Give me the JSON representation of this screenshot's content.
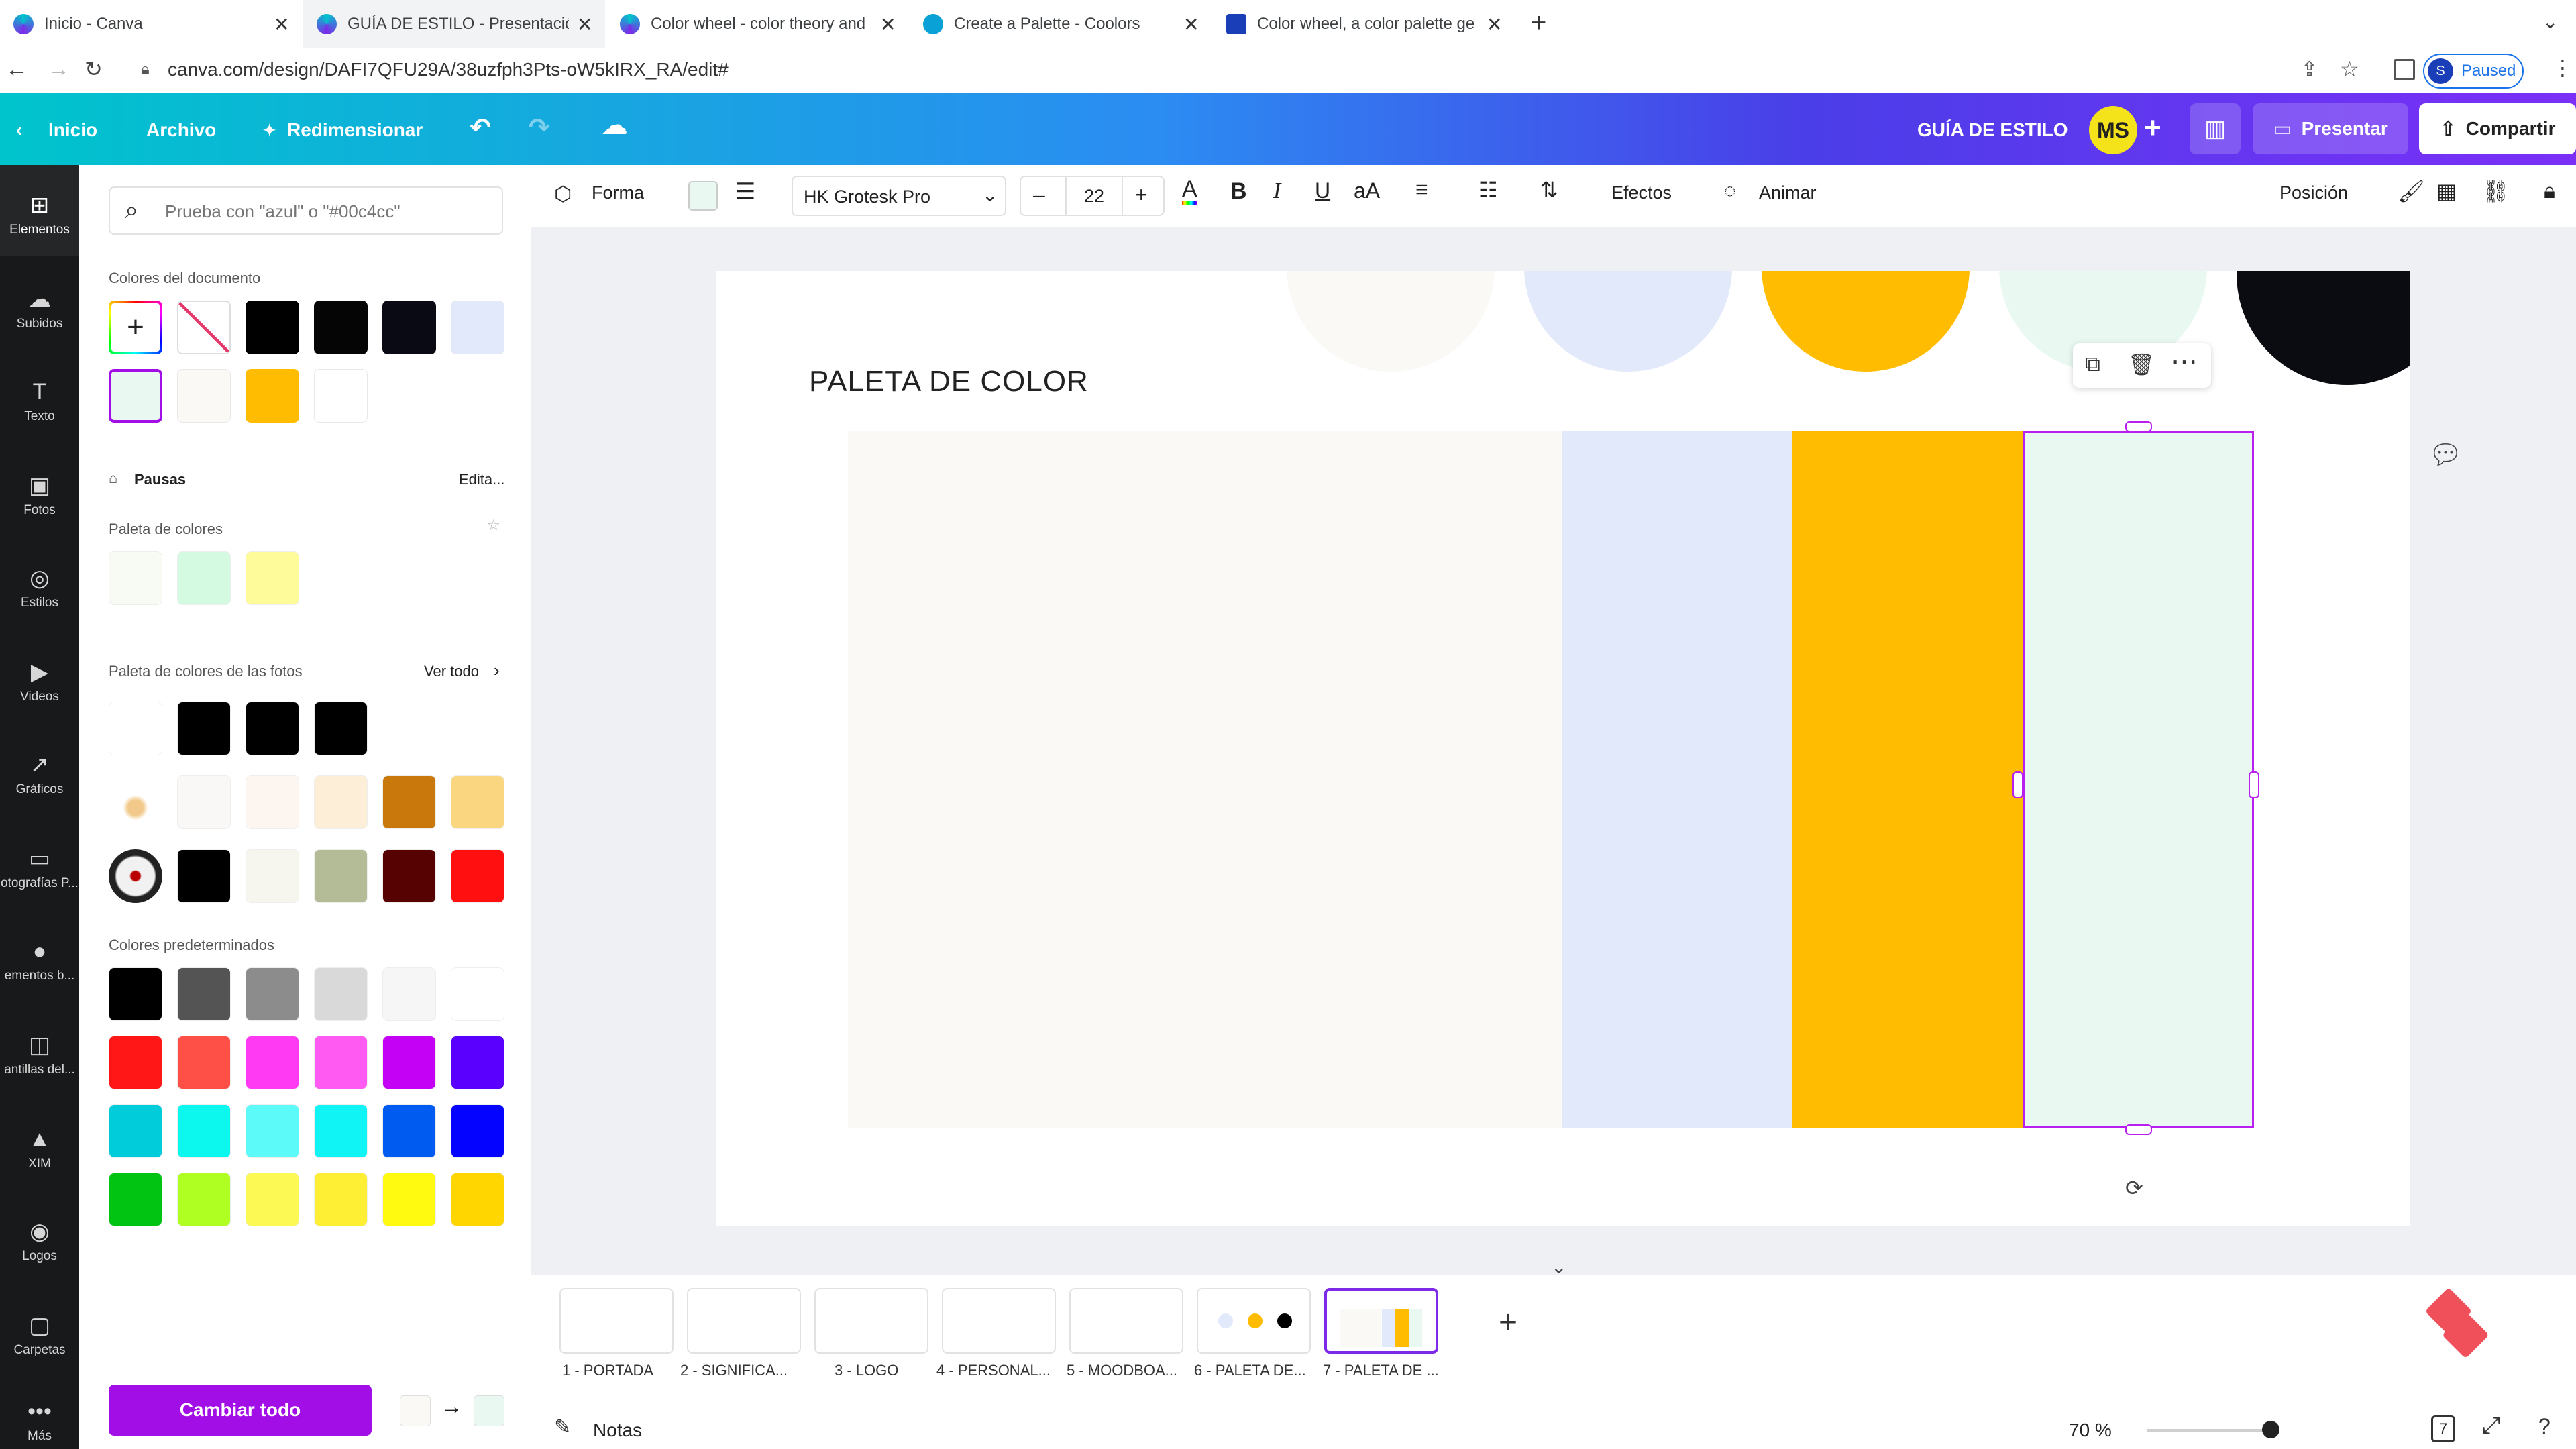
{
  "browser": {
    "tabs": [
      {
        "title": "Inicio - Canva"
      },
      {
        "title": "GUÍA DE ESTILO - Presentació"
      },
      {
        "title": "Color wheel - color theory and"
      },
      {
        "title": "Create a Palette - Coolors"
      },
      {
        "title": "Color wheel, a color palette ge"
      }
    ],
    "url": "canva.com/design/DAFI7QFU29A/38uzfph3Pts-oW5kIRX_RA/edit#",
    "profile_letter": "S",
    "profile_status": "Paused"
  },
  "header": {
    "home": "Inicio",
    "file": "Archivo",
    "resize": "Redimensionar",
    "design_title": "GUÍA DE ESTILO",
    "avatar": "MS",
    "present": "Presentar",
    "share": "Compartir"
  },
  "rail": [
    {
      "label": "Elementos"
    },
    {
      "label": "Subidos"
    },
    {
      "label": "Texto"
    },
    {
      "label": "Fotos"
    },
    {
      "label": "Estilos"
    },
    {
      "label": "Videos"
    },
    {
      "label": "Gráficos"
    },
    {
      "label": "otografías P..."
    },
    {
      "label": "ementos b..."
    },
    {
      "label": "antillas del..."
    },
    {
      "label": "XIM"
    },
    {
      "label": "Logos"
    },
    {
      "label": "Carpetas"
    },
    {
      "label": "Más"
    }
  ],
  "panel": {
    "search_placeholder": "Prueba con \"azul\" o \"#00c4cc\"",
    "doc_colors_title": "Colores del documento",
    "doc_colors": [
      "#000000",
      "#050505",
      "#0a0a14",
      "#e2e9fb",
      "#e9f9f1",
      "#faf9f5",
      "#ffbc00",
      "#ffffff"
    ],
    "brand_kit": "Pausas",
    "edit": "Edita...",
    "palette_title": "Paleta de colores",
    "palette": [
      "#f8faf4",
      "#d4fbe2",
      "#fdfb9a"
    ],
    "photo_palette_title": "Paleta de colores de las fotos",
    "see_all": "Ver todo",
    "photo_rows": [
      [
        "#000000",
        "#000000",
        "#000000"
      ],
      [
        "#f9f8f6",
        "#fdf6f0",
        "#fdefd7",
        "#c9790c",
        "#f9d67f"
      ],
      [
        "#000000",
        "#f6f6ef",
        "#b4bc97",
        "#570202",
        "#ff0f0f"
      ]
    ],
    "default_title": "Colores predeterminados",
    "default_colors": [
      [
        "#000000",
        "#545454",
        "#8c8c8c",
        "#d9d9d9",
        "#f6f6f6",
        "#ffffff"
      ],
      [
        "#ff1616",
        "#ff5048",
        "#ff3af2",
        "#ff5bf2",
        "#c400f5",
        "#5a00ff"
      ],
      [
        "#00cdd9",
        "#0cf7ee",
        "#5cfaf9",
        "#10f4f6",
        "#005cf0",
        "#0303ff"
      ],
      [
        "#00c312",
        "#b0ff23",
        "#fdf954",
        "#ffef34",
        "#fffa10",
        "#ffd600"
      ]
    ],
    "change_all": "Cambiar todo",
    "from_color": "#faf9f5",
    "to_color": "#e9f9f1"
  },
  "toolbar": {
    "shape": "Forma",
    "fill_color": "#e9f9f1",
    "font": "HK Grotesk Pro",
    "size": "22",
    "effects": "Efectos",
    "animate": "Animar",
    "position": "Posición"
  },
  "canvas": {
    "title": "PALETA DE COLOR",
    "palette": [
      "#faf9f5",
      "#e2e9fb",
      "#ffbc00",
      "#e9f9f1",
      "#0b0b12"
    ]
  },
  "pages": [
    {
      "label": "1 - PORTADA"
    },
    {
      "label": "2 - SIGNIFICA..."
    },
    {
      "label": "3 - LOGO"
    },
    {
      "label": "4 - PERSONAL..."
    },
    {
      "label": "5 - MOODBOA..."
    },
    {
      "label": "6 - PALETA DE..."
    },
    {
      "label": "7 - PALETA DE ..."
    }
  ],
  "footer": {
    "notes": "Notas",
    "zoom": "70 %",
    "page_count": "7"
  }
}
